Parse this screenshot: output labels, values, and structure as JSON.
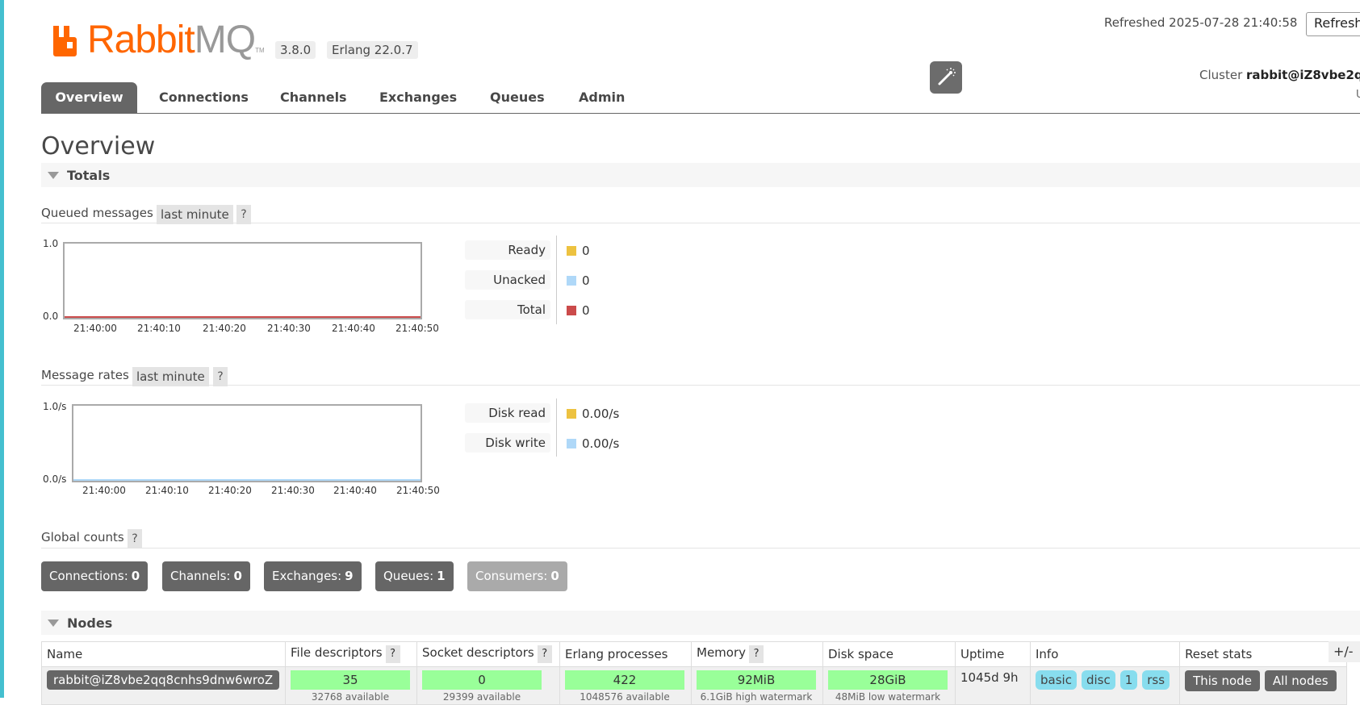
{
  "app": {
    "logo_text_a": "Rabbit",
    "logo_text_b": "MQ",
    "logo_tm": "TM",
    "version": "3.8.0",
    "erlang": "Erlang 22.0.7",
    "refreshed": "Refreshed 2025-07-28 21:40:58",
    "refresh_button": "Refresh",
    "cluster_label": "Cluster",
    "cluster_name": "rabbit@iZ8vbe2q",
    "header_stub": "U"
  },
  "tabs": [
    "Overview",
    "Connections",
    "Channels",
    "Exchanges",
    "Queues",
    "Admin"
  ],
  "page_title": "Overview",
  "totals": {
    "title": "Totals",
    "queued": {
      "label": "Queued messages",
      "range": "last minute",
      "help": "?",
      "y_ticks": [
        "1.0",
        "0.0"
      ],
      "x_ticks": [
        "21:40:00",
        "21:40:10",
        "21:40:20",
        "21:40:30",
        "21:40:40",
        "21:40:50"
      ],
      "legend": [
        {
          "label": "Ready",
          "value": "0",
          "color": "#edc240"
        },
        {
          "label": "Unacked",
          "value": "0",
          "color": "#afd8f8"
        },
        {
          "label": "Total",
          "value": "0",
          "color": "#cb4b4b"
        }
      ]
    },
    "rates": {
      "label": "Message rates",
      "range": "last minute",
      "help": "?",
      "y_ticks": [
        "1.0/s",
        "0.0/s"
      ],
      "x_ticks": [
        "21:40:00",
        "21:40:10",
        "21:40:20",
        "21:40:30",
        "21:40:40",
        "21:40:50"
      ],
      "legend": [
        {
          "label": "Disk read",
          "value": "0.00/s",
          "color": "#edc240"
        },
        {
          "label": "Disk write",
          "value": "0.00/s",
          "color": "#afd8f8"
        }
      ]
    },
    "global": {
      "label": "Global counts",
      "help": "?",
      "counts": [
        {
          "label": "Connections:",
          "value": "0"
        },
        {
          "label": "Channels:",
          "value": "0"
        },
        {
          "label": "Exchanges:",
          "value": "9"
        },
        {
          "label": "Queues:",
          "value": "1"
        },
        {
          "label": "Consumers:",
          "value": "0"
        }
      ]
    }
  },
  "nodes": {
    "title": "Nodes",
    "plus_minus": "+/-",
    "help": "?",
    "columns": [
      "Name",
      "File descriptors",
      "Socket descriptors",
      "Erlang processes",
      "Memory",
      "Disk space",
      "Uptime",
      "Info",
      "Reset stats"
    ],
    "row": {
      "name": "rabbit@iZ8vbe2qq8cnhs9dnw6wroZ",
      "file_desc": "35",
      "file_desc_avail": "32768 available",
      "socket_desc": "0",
      "socket_desc_avail": "29399 available",
      "erlang_proc": "422",
      "erlang_proc_avail": "1048576 available",
      "memory": "92MiB",
      "memory_note": "6.1GiB high watermark",
      "disk": "28GiB",
      "disk_note": "48MiB low watermark",
      "uptime": "1045d 9h",
      "info": [
        "basic",
        "disc",
        "1",
        "rss"
      ],
      "reset": [
        "This node",
        "All nodes"
      ]
    }
  }
}
